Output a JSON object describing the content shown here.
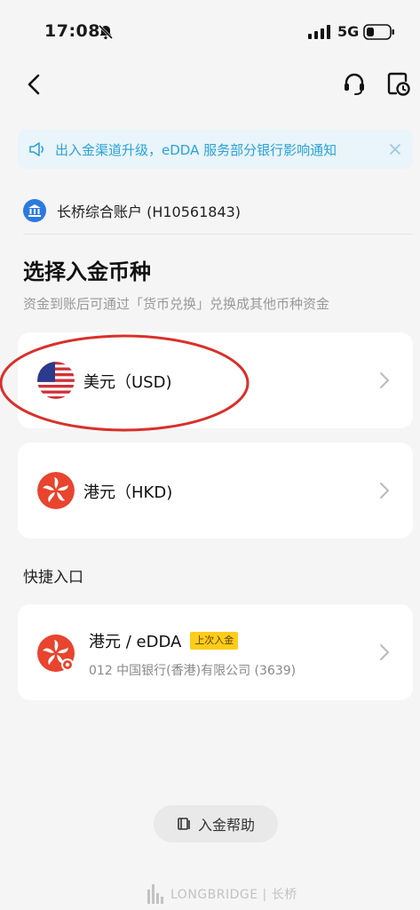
{
  "status_bar": {
    "time": "17:08",
    "network": "5G"
  },
  "notice": {
    "text": "出入金渠道升级，eDDA 服务部分银行影响通知"
  },
  "account": {
    "label": "长桥综合账户 (H10561843)"
  },
  "page": {
    "title": "选择入金币种",
    "subtitle": "资金到账后可通过「货币兑换」兑换成其他币种资金"
  },
  "currencies": [
    {
      "label": "美元（USD)"
    },
    {
      "label": "港元（HKD)"
    }
  ],
  "shortcut": {
    "section_label": "快捷入口",
    "title": "港元 / eDDA",
    "badge": "上次入金",
    "subtitle": "012 中国银行(香港)有限公司 (3639)"
  },
  "help": {
    "label": "入金帮助"
  },
  "footer": {
    "brand": "LONGBRIDGE | 长桥"
  },
  "colors": {
    "accent": "#2aa3d6",
    "hk_red": "#e8442e",
    "badge": "#ffcc1a",
    "annotation": "#d9302b"
  }
}
